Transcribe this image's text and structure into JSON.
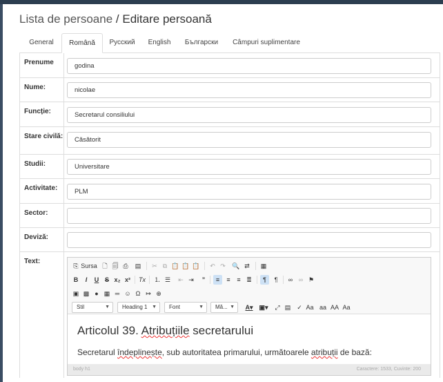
{
  "breadcrumb": {
    "parent": "Lista de persoane",
    "separator": "/",
    "current": "Editare persoană"
  },
  "tabs": [
    {
      "label": "General",
      "active": false
    },
    {
      "label": "Română",
      "active": true
    },
    {
      "label": "Русский",
      "active": false
    },
    {
      "label": "English",
      "active": false
    },
    {
      "label": "Български",
      "active": false
    },
    {
      "label": "Câmpuri suplimentare",
      "active": false
    }
  ],
  "fields": {
    "prenume": {
      "label": "Prenume",
      "value": "godina"
    },
    "nume": {
      "label": "Nume:",
      "value": "nicolae"
    },
    "functie": {
      "label": "Funcție:",
      "value": "Secretarul consiliului"
    },
    "stare_civila": {
      "label": "Stare civilă:",
      "value": "Căsătorit"
    },
    "studii": {
      "label": "Studii:",
      "value": "Universitare"
    },
    "activitate": {
      "label": "Activitate:",
      "value": "PLM"
    },
    "sector": {
      "label": "Sector:",
      "value": ""
    },
    "deviza": {
      "label": "Deviză:",
      "value": ""
    },
    "text": {
      "label": "Text:"
    }
  },
  "editor": {
    "source_label": "Sursa",
    "format_combos": {
      "style": "Stil",
      "format": "Heading 1",
      "font": "Font",
      "size": "Mă..."
    },
    "content_heading_parts": [
      "Articolul 39. ",
      "Atribuțiile",
      " secretarului"
    ],
    "content_paragraph_parts": [
      "Secretarul ",
      "îndeplinește",
      ", sub autoritatea primarului, următoarele ",
      "atribuții",
      " de bază:"
    ],
    "status_path": "body  h1",
    "status_counts": "Caractere: 1533, Cuvinte: 200"
  }
}
